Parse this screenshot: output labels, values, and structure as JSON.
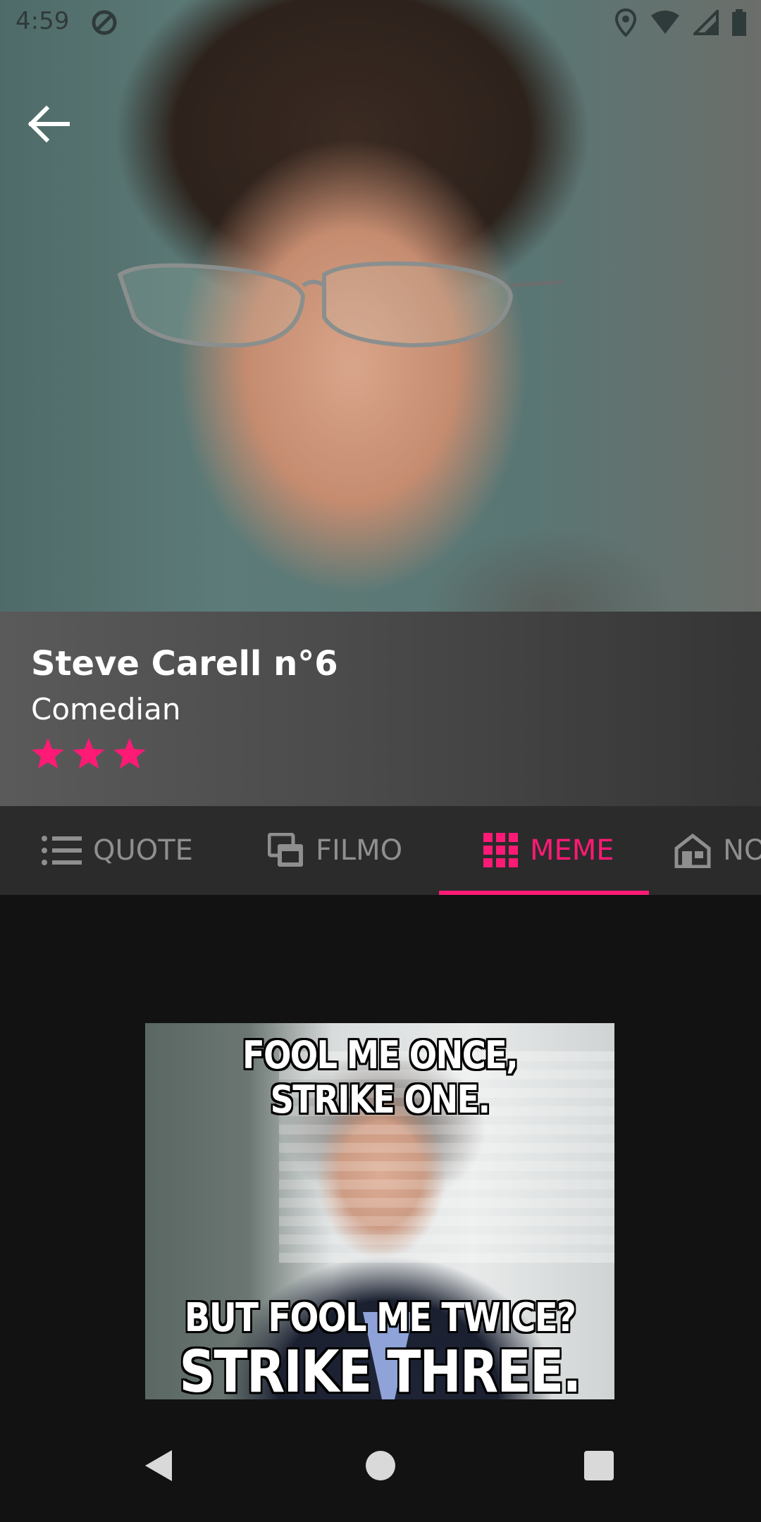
{
  "status_bar": {
    "time": "4:59"
  },
  "profile": {
    "name": "Steve Carell n°6",
    "role": "Comedian",
    "rating": 3,
    "star_color": "#ff1a75"
  },
  "tabs": [
    {
      "label": "QUOTE",
      "icon": "list-icon"
    },
    {
      "label": "FILMO",
      "icon": "copy-icon"
    },
    {
      "label": "MEME",
      "icon": "grid-icon",
      "active": true
    },
    {
      "label": "NO",
      "icon": "home-icon"
    }
  ],
  "meme": {
    "top_text": "FOOL ME ONCE, STRIKE ONE.",
    "middle_text": "BUT FOOL ME TWICE?",
    "bottom_text": "STRIKE THREE."
  },
  "colors": {
    "accent": "#ff1a75",
    "tab_bar": "#2b2b2b",
    "background": "#121212",
    "inactive_tab": "#8f8f8f"
  }
}
